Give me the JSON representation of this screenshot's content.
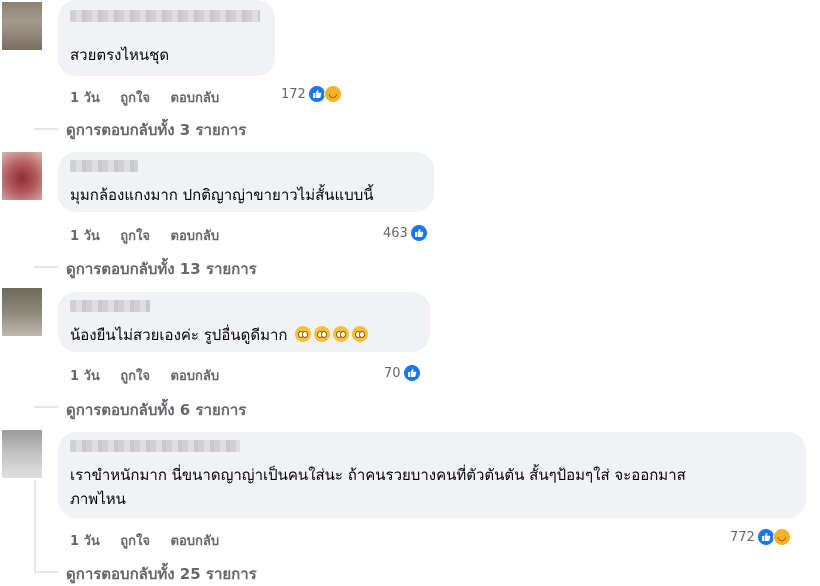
{
  "comments": [
    {
      "text_lines": [
        "สวยตรงไหนชุด"
      ],
      "time": "1 วัน",
      "like_label": "ถูกใจ",
      "reply_label": "ตอบกลับ",
      "reaction_count": "172",
      "reactions": [
        "like",
        "haha"
      ],
      "replies_label": "ดูการตอบกลับทั้ง 3 รายการ"
    },
    {
      "text_lines": [
        "มุมกล้องแกงมาก ปกติญาญ่าขายาวไม่สั้นแบบนี้"
      ],
      "time": "1 วัน",
      "like_label": "ถูกใจ",
      "reply_label": "ตอบกลับ",
      "reaction_count": "463",
      "reactions": [
        "like"
      ],
      "replies_label": "ดูการตอบกลับทั้ง 13 รายการ"
    },
    {
      "text_lines": [
        "น้องยืนไม่สวยเองค่ะ รูปอื่นดูดีมาก"
      ],
      "time": "1 วัน",
      "like_label": "ถูกใจ",
      "reply_label": "ตอบกลับ",
      "reaction_count": "70",
      "reactions": [
        "like"
      ],
      "replies_label": "ดูการตอบกลับทั้ง 6 รายการ"
    },
    {
      "text_lines": [
        "เราขำหนักมาก นี่ขนาดญาญ่าเป็นคนใส่นะ ถ้าคนรวยบางคนที่ตัวตันตัน สั้นๆป้อมๆใส่ จะออกมาส",
        "ภาพไหน"
      ],
      "time": "1 วัน",
      "like_label": "ถูกใจ",
      "reply_label": "ตอบกลับ",
      "reaction_count": "772",
      "reactions": [
        "like",
        "haha"
      ],
      "replies_label": "ดูการตอบกลับทั้ง 25 รายการ"
    }
  ],
  "colors": {
    "like": "#1877f2",
    "haha": "#f7b125",
    "bubble": "#f0f2f5",
    "meta": "#65676b"
  }
}
